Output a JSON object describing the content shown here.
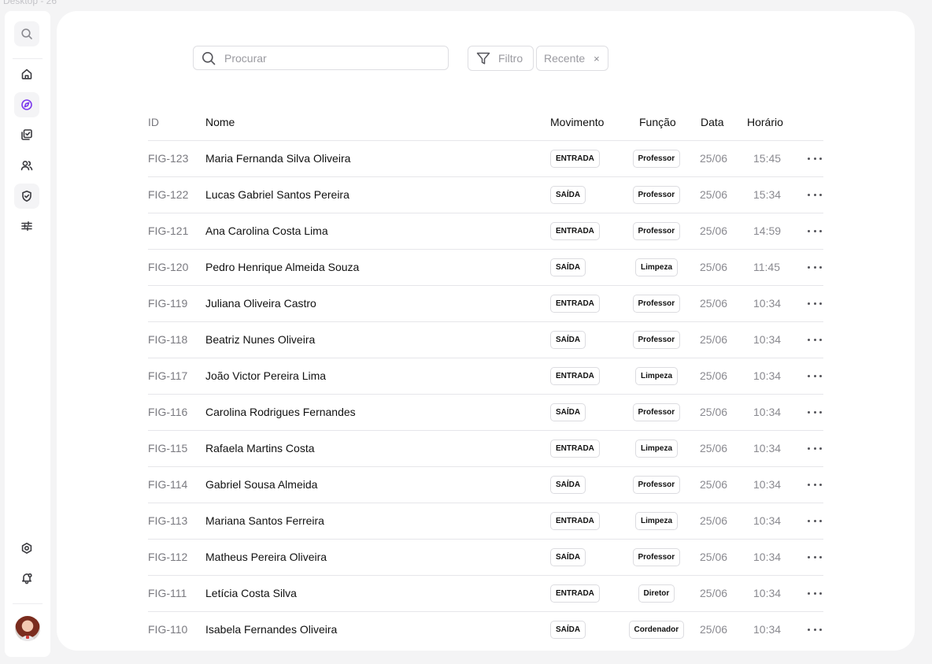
{
  "frame_label": "Desktop - 26",
  "sidebar": {
    "search_icon": "search-icon",
    "nav": [
      "home-icon",
      "compass-icon",
      "checklist-icon",
      "users-icon",
      "shield-check-icon",
      "sliders-icon"
    ],
    "bottom": [
      "settings-icon",
      "bell-icon"
    ],
    "active_color": "#7c3aed"
  },
  "toolbar": {
    "search_placeholder": "Procurar",
    "filter_label": "Filtro",
    "recent_label": "Recente",
    "recent_close": "×"
  },
  "table": {
    "headers": {
      "id": "ID",
      "name": "Nome",
      "movement": "Movimento",
      "role": "Função",
      "date": "Data",
      "time": "Horário"
    },
    "rows": [
      {
        "id": "FIG-123",
        "name": "Maria Fernanda Silva Oliveira",
        "movement": "ENTRADA",
        "role": "Professor",
        "date": "25/06",
        "time": "15:45"
      },
      {
        "id": "FIG-122",
        "name": "Lucas Gabriel Santos Pereira",
        "movement": "SAÍDA",
        "role": "Professor",
        "date": "25/06",
        "time": "15:34"
      },
      {
        "id": "FIG-121",
        "name": "Ana Carolina Costa Lima",
        "movement": "ENTRADA",
        "role": "Professor",
        "date": "25/06",
        "time": "14:59"
      },
      {
        "id": "FIG-120",
        "name": "Pedro Henrique Almeida Souza",
        "movement": "SAÍDA",
        "role": "Limpeza",
        "date": "25/06",
        "time": "11:45"
      },
      {
        "id": "FIG-119",
        "name": "Juliana Oliveira Castro",
        "movement": "ENTRADA",
        "role": "Professor",
        "date": "25/06",
        "time": "10:34"
      },
      {
        "id": "FIG-118",
        "name": "Beatriz Nunes Oliveira",
        "movement": "SAÍDA",
        "role": "Professor",
        "date": "25/06",
        "time": "10:34"
      },
      {
        "id": "FIG-117",
        "name": "João Victor Pereira Lima",
        "movement": "ENTRADA",
        "role": "Limpeza",
        "date": "25/06",
        "time": "10:34"
      },
      {
        "id": "FIG-116",
        "name": "Carolina Rodrigues Fernandes",
        "movement": "SAÍDA",
        "role": "Professor",
        "date": "25/06",
        "time": "10:34"
      },
      {
        "id": "FIG-115",
        "name": "Rafaela Martins Costa",
        "movement": "ENTRADA",
        "role": "Limpeza",
        "date": "25/06",
        "time": "10:34"
      },
      {
        "id": "FIG-114",
        "name": "Gabriel Sousa Almeida",
        "movement": "SAÍDA",
        "role": "Professor",
        "date": "25/06",
        "time": "10:34"
      },
      {
        "id": "FIG-113",
        "name": "Mariana Santos Ferreira",
        "movement": "ENTRADA",
        "role": "Limpeza",
        "date": "25/06",
        "time": "10:34"
      },
      {
        "id": "FIG-112",
        "name": "Matheus Pereira Oliveira",
        "movement": "SAÍDA",
        "role": "Professor",
        "date": "25/06",
        "time": "10:34"
      },
      {
        "id": "FIG-111",
        "name": "Letícia Costa Silva",
        "movement": "ENTRADA",
        "role": "Diretor",
        "date": "25/06",
        "time": "10:34"
      },
      {
        "id": "FIG-110",
        "name": "Isabela Fernandes Oliveira",
        "movement": "SAÍDA",
        "role": "Cordenador",
        "date": "25/06",
        "time": "10:34"
      }
    ],
    "row_action_icon": "more-horizontal-icon"
  }
}
